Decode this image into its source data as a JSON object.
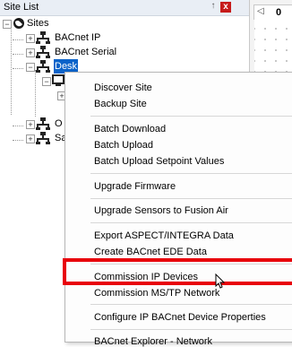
{
  "panel": {
    "title": "Site List",
    "pin_glyph": "↑",
    "close_glyph": "x"
  },
  "doc_tab": {
    "arrow_glyph": "◁",
    "label": "0"
  },
  "tree": {
    "root": "Sites",
    "children": [
      {
        "label": "BACnet IP"
      },
      {
        "label": "BACnet Serial"
      },
      {
        "label": "Desk",
        "selected": true
      },
      {
        "label": "O"
      },
      {
        "label": "Sa"
      }
    ]
  },
  "context_menu": {
    "items": [
      "Discover Site",
      "Backup Site",
      "Batch Download",
      "Batch Upload",
      "Batch Upload Setpoint Values",
      "Upgrade Firmware",
      "Upgrade Sensors to Fusion Air",
      "Export ASPECT/INTEGRA Data",
      "Create BACnet EDE Data",
      "Commission IP Devices",
      "Commission MS/TP Network",
      "Configure IP BACnet Device Properties",
      "BACnet Explorer - Network"
    ],
    "highlighted_item": "Commission IP Devices"
  },
  "colors": {
    "selection": "#0b63c9",
    "highlight_box": "#e8000b",
    "close_button": "#c61b1b"
  }
}
